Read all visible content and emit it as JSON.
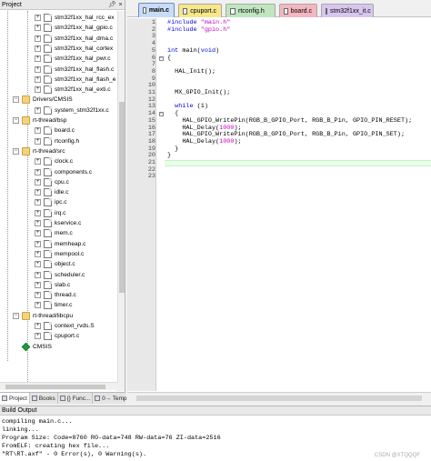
{
  "project_panel": {
    "title": "Project",
    "header_buttons": {
      "pin": "\u0002",
      "close": "×"
    },
    "tree": [
      {
        "label": "stm32f1xx_hal_rcc_ex",
        "type": "file",
        "level": 3
      },
      {
        "label": "stm32f1xx_hal_gpio.c",
        "type": "file",
        "level": 3
      },
      {
        "label": "stm32f1xx_hal_dma.c",
        "type": "file",
        "level": 3
      },
      {
        "label": "stm32f1xx_hal_cortex",
        "type": "file",
        "level": 3
      },
      {
        "label": "stm32f1xx_hal_pwr.c",
        "type": "file",
        "level": 3
      },
      {
        "label": "stm32f1xx_hal_flash.c",
        "type": "file",
        "level": 3
      },
      {
        "label": "stm32f1xx_hal_flash_e",
        "type": "file",
        "level": 3
      },
      {
        "label": "stm32f1xx_hal_exti.c",
        "type": "file",
        "level": 3
      },
      {
        "label": "Drivers/CMSIS",
        "type": "folder",
        "level": 2
      },
      {
        "label": "system_stm32f1xx.c",
        "type": "file",
        "level": 3
      },
      {
        "label": "rt-thread/bsp",
        "type": "folder",
        "level": 2
      },
      {
        "label": "board.c",
        "type": "file",
        "level": 3
      },
      {
        "label": "rtconfig.h",
        "type": "file",
        "level": 3
      },
      {
        "label": "rt-thread/src",
        "type": "folder",
        "level": 2
      },
      {
        "label": "clock.c",
        "type": "file",
        "level": 3
      },
      {
        "label": "components.c",
        "type": "file",
        "level": 3
      },
      {
        "label": "cpu.c",
        "type": "file",
        "level": 3
      },
      {
        "label": "idle.c",
        "type": "file",
        "level": 3
      },
      {
        "label": "ipc.c",
        "type": "file",
        "level": 3
      },
      {
        "label": "irq.c",
        "type": "file",
        "level": 3
      },
      {
        "label": "kservice.c",
        "type": "file",
        "level": 3
      },
      {
        "label": "mem.c",
        "type": "file",
        "level": 3
      },
      {
        "label": "memheap.c",
        "type": "file",
        "level": 3
      },
      {
        "label": "mempool.c",
        "type": "file",
        "level": 3
      },
      {
        "label": "object.c",
        "type": "file",
        "level": 3
      },
      {
        "label": "scheduler.c",
        "type": "file",
        "level": 3
      },
      {
        "label": "slab.c",
        "type": "file",
        "level": 3
      },
      {
        "label": "thread.c",
        "type": "file",
        "level": 3
      },
      {
        "label": "timer.c",
        "type": "file",
        "level": 3
      },
      {
        "label": "rt-thread/libcpu",
        "type": "folder",
        "level": 2
      },
      {
        "label": "context_rvds.S",
        "type": "file",
        "level": 3
      },
      {
        "label": "cpuport.c",
        "type": "file",
        "level": 3
      },
      {
        "label": "CMSIS",
        "type": "gem",
        "level": 2
      }
    ],
    "bottom_tabs": [
      {
        "label": "Project",
        "active": true
      },
      {
        "label": "Books",
        "active": false
      },
      {
        "label": "{} Func...",
        "active": false
      },
      {
        "label": "0→ Temp...",
        "active": false
      }
    ]
  },
  "editor": {
    "tabs": [
      {
        "label": "main.c",
        "active": true,
        "color": "#c8dcf6"
      },
      {
        "label": "cpuport.c",
        "active": false,
        "color": "#f7e68a"
      },
      {
        "label": "rtconfig.h",
        "active": false,
        "color": "#bfe6bf"
      },
      {
        "label": "board.c",
        "active": false,
        "color": "#f4b6c0"
      },
      {
        "label": "stm32f1xx_it.c",
        "active": false,
        "color": "#d8c6ee"
      }
    ],
    "current_line": 21,
    "lines": [
      {
        "n": "1",
        "text": "#include \"main.h\""
      },
      {
        "n": "2",
        "text": "#include \"gpio.h\""
      },
      {
        "n": "3",
        "text": ""
      },
      {
        "n": "4",
        "text": ""
      },
      {
        "n": "5",
        "text": "int main(void)"
      },
      {
        "n": "6",
        "text": "{"
      },
      {
        "n": "7",
        "text": ""
      },
      {
        "n": "8",
        "text": "  HAL_Init();"
      },
      {
        "n": "9",
        "text": ""
      },
      {
        "n": "10",
        "text": ""
      },
      {
        "n": "11",
        "text": "  MX_GPIO_Init();"
      },
      {
        "n": "12",
        "text": ""
      },
      {
        "n": "13",
        "text": "  while (1)"
      },
      {
        "n": "14",
        "text": "  {"
      },
      {
        "n": "15",
        "text": "    HAL_GPIO_WritePin(RGB_B_GPIO_Port, RGB_B_Pin, GPIO_PIN_RESET);"
      },
      {
        "n": "16",
        "text": "    HAL_Delay(1000);"
      },
      {
        "n": "17",
        "text": "    HAL_GPIO_WritePin(RGB_B_GPIO_Port, RGB_B_Pin, GPIO_PIN_SET);"
      },
      {
        "n": "18",
        "text": "    HAL_Delay(1000);"
      },
      {
        "n": "19",
        "text": "  }"
      },
      {
        "n": "20",
        "text": "}"
      },
      {
        "n": "21",
        "text": ""
      },
      {
        "n": "22",
        "text": ""
      },
      {
        "n": "23",
        "text": ""
      }
    ]
  },
  "build_output": {
    "title": "Build Output",
    "lines": [
      "compiling main.c...",
      "linking...",
      "Program Size: Code=8760 RO-data=748 RW-data=76 ZI-data=2516",
      "FromELF: creating hex file...",
      "\"RT\\RT.axf\" - 0 Error(s), 0 Warning(s)."
    ],
    "watermark": "CSDN @XTQQQF"
  }
}
